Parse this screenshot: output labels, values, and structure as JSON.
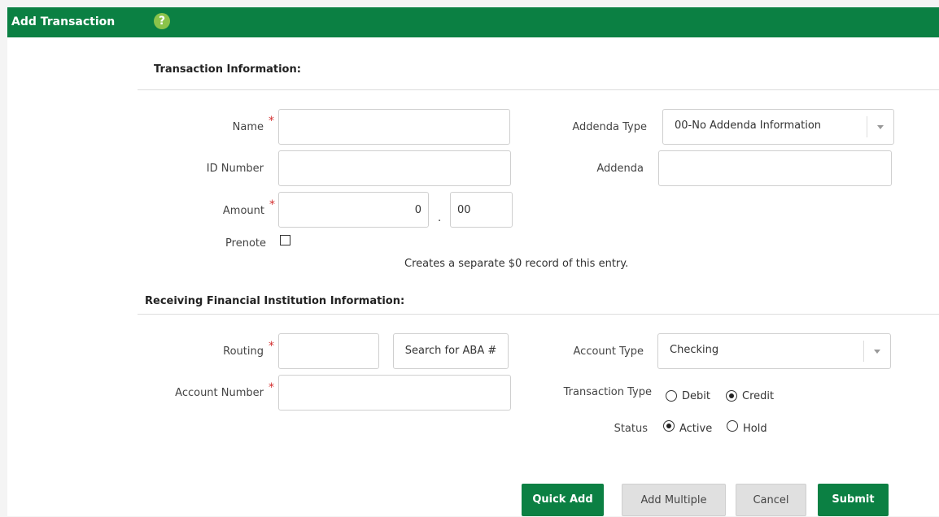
{
  "header": {
    "title": "Add Transaction",
    "help_glyph": "?"
  },
  "transaction_section": {
    "title": "Transaction Information:",
    "name_label": "Name",
    "id_label": "ID Number",
    "amount_label": "Amount",
    "amount_dollars": "0",
    "amount_separator": ".",
    "amount_cents": "00",
    "prenote_label": "Prenote",
    "prenote_note": "Creates a separate $0 record of this entry.",
    "addenda_type_label": "Addenda Type",
    "addenda_type_value": "00-No Addenda Information",
    "addenda_label": "Addenda",
    "required_marker": "*"
  },
  "rfi_section": {
    "title": "Receiving Financial Institution Information:",
    "routing_label": "Routing",
    "search_aba_label": "Search for ABA #",
    "account_number_label": "Account Number",
    "account_type_label": "Account Type",
    "account_type_value": "Checking",
    "transaction_type_label": "Transaction Type",
    "transaction_type_options": [
      "Debit",
      "Credit"
    ],
    "transaction_type_selected": "Credit",
    "status_label": "Status",
    "status_options": [
      "Active",
      "Hold"
    ],
    "status_selected": "Active"
  },
  "buttons": {
    "quick_add": "Quick Add",
    "add_multiple": "Add Multiple",
    "cancel": "Cancel",
    "submit": "Submit"
  },
  "colors": {
    "brand_green": "#0b8043",
    "help_green": "#8bc34a",
    "required_red": "#d32f2f"
  },
  "icons": [
    "help-icon",
    "chevron-down-icon"
  ]
}
